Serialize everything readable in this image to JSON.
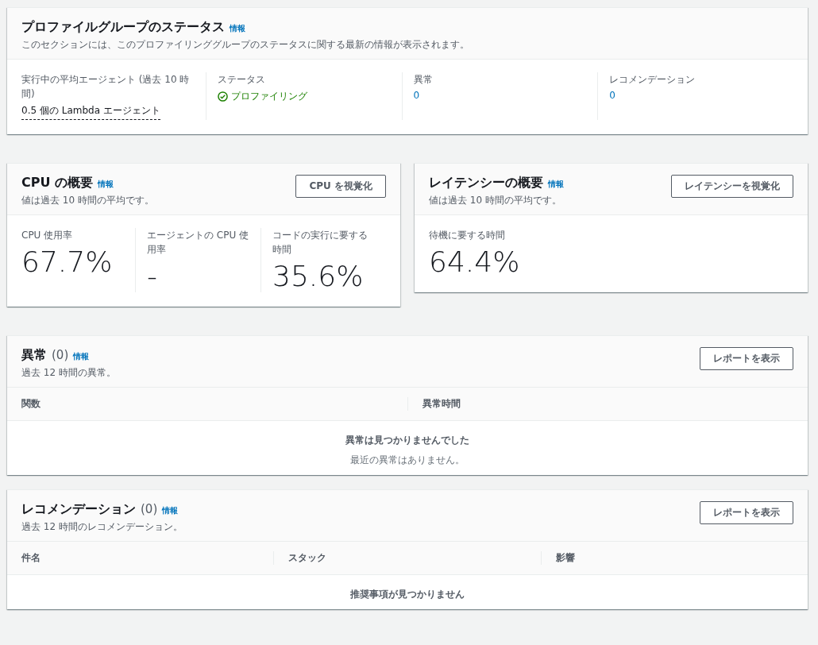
{
  "status_panel": {
    "title": "プロファイルグループのステータス",
    "info": "情報",
    "description": "このセクションには、このプロファイリンググループのステータスに関する最新の情報が表示されます。",
    "metrics": [
      {
        "kind": "tooltip",
        "label": "実行中の平均エージェント (過去 10 時間)",
        "value": "0.5 個の Lambda エージェント"
      },
      {
        "kind": "status",
        "label": "ステータス",
        "value": "プロファイリング"
      },
      {
        "kind": "link",
        "label": "異常",
        "value": "0"
      },
      {
        "kind": "link",
        "label": "レコメンデーション",
        "value": "0"
      }
    ]
  },
  "summaries": [
    {
      "title": "CPU の概要",
      "info": "情報",
      "description": "値は過去 10 時間の平均です。",
      "button": "CPU を視覚化",
      "metrics": [
        {
          "label": "CPU 使用率",
          "value": "67.7%"
        },
        {
          "label": "エージェントの CPU 使用率",
          "value": "-"
        },
        {
          "label": "コードの実行に要する時間",
          "value": "35.6%"
        }
      ]
    },
    {
      "title": "レイテンシーの概要",
      "info": "情報",
      "description": "値は過去 10 時間の平均です。",
      "button": "レイテンシーを視覚化",
      "metrics": [
        {
          "label": "待機に要する時間",
          "value": "64.4%"
        }
      ]
    }
  ],
  "tables": [
    {
      "title": "異常",
      "count": "(0)",
      "info": "情報",
      "description": "過去 12 時間の異常。",
      "button": "レポートを表示",
      "columns": [
        "関数",
        "異常時間"
      ],
      "empty_title": "異常は見つかりませんでした",
      "empty_text": "最近の異常はありません。"
    },
    {
      "title": "レコメンデーション",
      "count": "(0)",
      "info": "情報",
      "description": "過去 12 時間のレコメンデーション。",
      "button": "レポートを表示",
      "columns": [
        "件名",
        "スタック",
        "影響"
      ],
      "empty_title": "推奨事項が見つかりません"
    }
  ]
}
